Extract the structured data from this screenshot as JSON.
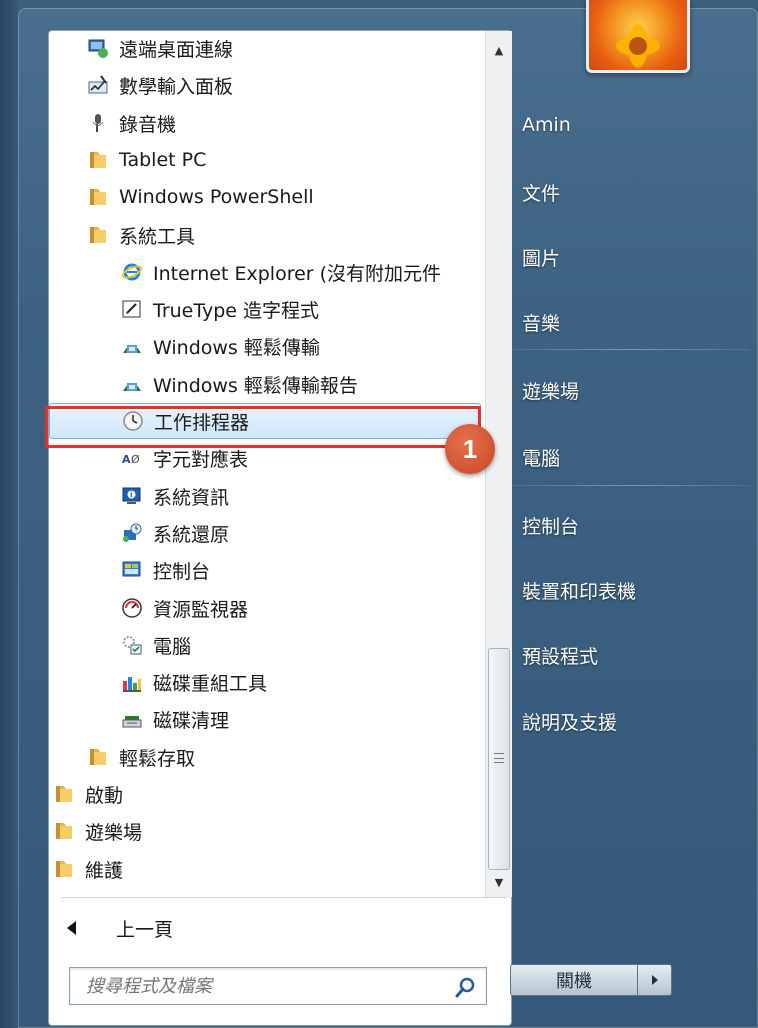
{
  "programs": [
    {
      "label": "遠端桌面連線",
      "indent": 2,
      "icon": "remote-desktop-icon"
    },
    {
      "label": "數學輸入面板",
      "indent": 2,
      "icon": "math-input-icon"
    },
    {
      "label": "錄音機",
      "indent": 2,
      "icon": "microphone-icon"
    },
    {
      "label": "Tablet PC",
      "indent": 2,
      "icon": "folder-icon"
    },
    {
      "label": "Windows PowerShell",
      "indent": 2,
      "icon": "folder-icon"
    },
    {
      "label": "系統工具",
      "indent": 2,
      "icon": "folder-icon"
    },
    {
      "label": "Internet Explorer (沒有附加元件",
      "indent": 3,
      "icon": "internet-explorer-icon"
    },
    {
      "label": "TrueType 造字程式",
      "indent": 3,
      "icon": "private-character-editor-icon"
    },
    {
      "label": "Windows 輕鬆傳輸",
      "indent": 3,
      "icon": "easy-transfer-icon"
    },
    {
      "label": "Windows 輕鬆傳輸報告",
      "indent": 3,
      "icon": "easy-transfer-icon"
    },
    {
      "label": "工作排程器",
      "indent": 3,
      "icon": "clock-icon",
      "selected": true
    },
    {
      "label": "字元對應表",
      "indent": 3,
      "icon": "character-map-icon"
    },
    {
      "label": "系統資訊",
      "indent": 3,
      "icon": "system-info-icon"
    },
    {
      "label": "系統還原",
      "indent": 3,
      "icon": "system-restore-icon"
    },
    {
      "label": "控制台",
      "indent": 3,
      "icon": "control-panel-icon"
    },
    {
      "label": "資源監視器",
      "indent": 3,
      "icon": "resource-monitor-icon"
    },
    {
      "label": "電腦",
      "indent": 3,
      "icon": "computer-icon"
    },
    {
      "label": "磁碟重組工具",
      "indent": 3,
      "icon": "defragmenter-icon"
    },
    {
      "label": "磁碟清理",
      "indent": 3,
      "icon": "disk-cleanup-icon"
    },
    {
      "label": "輕鬆存取",
      "indent": 2,
      "icon": "folder-icon"
    },
    {
      "label": "啟動",
      "indent": 1,
      "icon": "folder-icon"
    },
    {
      "label": "遊樂場",
      "indent": 1,
      "icon": "folder-icon"
    },
    {
      "label": "維護",
      "indent": 1,
      "icon": "folder-icon"
    }
  ],
  "back_label": "上一頁",
  "search": {
    "placeholder": "搜尋程式及檔案"
  },
  "callout_number": "1",
  "right_menu": {
    "user_name": "Amin",
    "items": [
      "文件",
      "圖片",
      "音樂",
      "遊樂場",
      "電腦",
      "控制台",
      "裝置和印表機",
      "預設程式",
      "說明及支援"
    ]
  },
  "shutdown_label": "關機",
  "colors": {
    "highlight": "#e53030",
    "callout": "#d9573a"
  }
}
